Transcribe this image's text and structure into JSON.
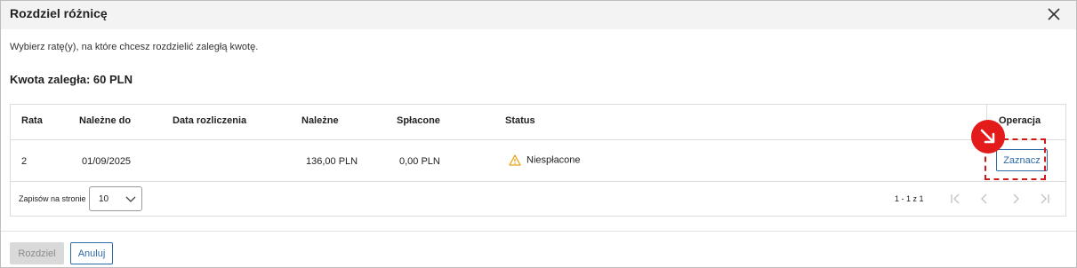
{
  "dialog": {
    "title": "Rozdziel różnicę",
    "close_icon": "close-icon",
    "instruction": "Wybierz ratę(y), na które chcesz rozdzielić zaległą kwotę.",
    "overdue_amount": "Kwota zaległa: 60 PLN"
  },
  "table": {
    "headers": [
      "Rata",
      "Należne do",
      "Data rozliczenia",
      "Należne",
      "Spłacone",
      "Status",
      "Operacja"
    ],
    "rows": [
      {
        "rata": "2",
        "due_date": "01/09/2025",
        "settlement_date": "",
        "due_amount": "136,00 PLN",
        "paid_amount": "0,00 PLN",
        "status": "Niespłacone",
        "status_icon": "warning-icon",
        "action_label": "Zaznacz"
      }
    ]
  },
  "pagination": {
    "per_page_label": "Zapisów na stronie",
    "per_page_value": "10",
    "range": "1 - 1 z 1",
    "icons": [
      "first-page-icon",
      "prev-page-icon",
      "next-page-icon",
      "last-page-icon"
    ]
  },
  "footer": {
    "split_label": "Rozdziel",
    "cancel_label": "Anuluj"
  },
  "colors": {
    "accent": "#2d6aa6",
    "warning": "#e8a317",
    "annotation": "#e31b1b",
    "header_bg": "#f3f3f3"
  }
}
